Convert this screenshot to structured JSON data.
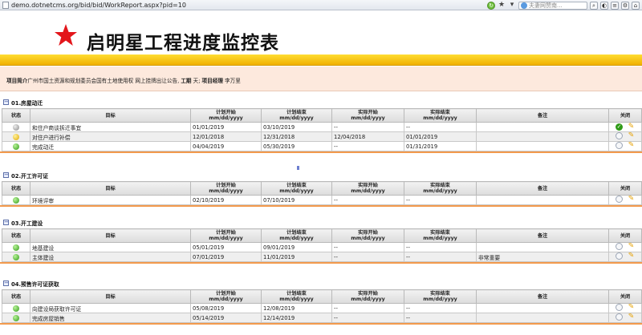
{
  "browser": {
    "url": "demo.dotnetcms.org/bid/bid/WorkReport.aspx?pid=10",
    "search_placeholder": "夫妻网赞南..."
  },
  "page": {
    "title": "启明星工程进度监控表"
  },
  "info": {
    "intro_label": "项目简介",
    "intro_text": "广州市国土资源和规划委员会国有土地使用权 网上挂牌出让公告,",
    "duration_label": "工期",
    "duration_value": "天;",
    "manager_label": "项目经理",
    "manager_value": "李万里"
  },
  "columns": {
    "status": "状态",
    "target": "目标",
    "plan_start": "计划开始",
    "plan_end": "计划结束",
    "actual_start": "实际开始",
    "actual_end": "实际结束",
    "date_format": "mm/dd/yyyy",
    "note": "备注",
    "close": "关闭"
  },
  "sections": [
    {
      "title": "01.房屋动迁",
      "rows": [
        {
          "status": "gray",
          "target": "和住户商谈拆迁事宜",
          "plan_start": "01/01/2019",
          "plan_end": "03/10/2019",
          "actual_start": "--",
          "actual_end": "--",
          "note": "",
          "closed": true
        },
        {
          "status": "yellow",
          "target": "对住户进行补偿",
          "plan_start": "12/01/2018",
          "plan_end": "12/31/2018",
          "actual_start": "12/04/2018",
          "actual_end": "01/01/2019",
          "note": "",
          "closed": false
        },
        {
          "status": "green",
          "target": "完成动迁",
          "plan_start": "04/04/2019",
          "plan_end": "05/30/2019",
          "actual_start": "--",
          "actual_end": "01/31/2019",
          "note": "",
          "closed": false
        }
      ]
    },
    {
      "title": "02.开工许可证",
      "rows": [
        {
          "status": "green",
          "target": "环境评审",
          "plan_start": "02/10/2019",
          "plan_end": "07/10/2019",
          "actual_start": "--",
          "actual_end": "--",
          "note": "",
          "closed": false
        }
      ]
    },
    {
      "title": "03.开工建设",
      "rows": [
        {
          "status": "green",
          "target": "地基建设",
          "plan_start": "05/01/2019",
          "plan_end": "09/01/2019",
          "actual_start": "--",
          "actual_end": "--",
          "note": "",
          "closed": false
        },
        {
          "status": "green",
          "target": "主体建设",
          "plan_start": "07/01/2019",
          "plan_end": "11/01/2019",
          "actual_start": "--",
          "actual_end": "--",
          "note": "非常重要",
          "closed": false
        }
      ]
    },
    {
      "title": "04.预售许可证获取",
      "rows": [
        {
          "status": "green",
          "target": "向建设局获取许可证",
          "plan_start": "05/08/2019",
          "plan_end": "12/08/2019",
          "actual_start": "--",
          "actual_end": "--",
          "note": "",
          "closed": false
        },
        {
          "status": "green",
          "target": "完成房屋销售",
          "plan_start": "05/14/2019",
          "plan_end": "12/14/2019",
          "actual_start": "--",
          "actual_end": "--",
          "note": "",
          "closed": false
        }
      ]
    }
  ],
  "colors": {
    "accent_orange": "#f39a4d",
    "header_yellow": "#f0b000",
    "info_bg": "#fde9dd",
    "logo_star": "#e3161b"
  }
}
